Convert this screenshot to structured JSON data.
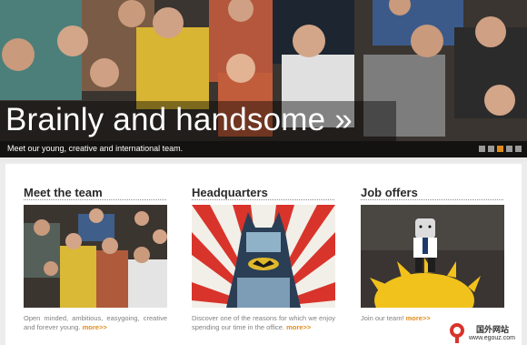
{
  "hero": {
    "title": "Brainly and handsome »",
    "caption": "Meet our young, creative and international team.",
    "slides": 5,
    "active_slide": 2
  },
  "columns": [
    {
      "title": "Meet the team",
      "text": "Open minded, ambitious, easygoing, creative and forever young.",
      "more": "more>>"
    },
    {
      "title": "Headquarters",
      "text": "Discover one of the reasons for which we enjoy spending our time in the office.",
      "more": "more>>"
    },
    {
      "title": "Job offers",
      "text": "Join our team!",
      "more": "more>>"
    }
  ],
  "watermark": {
    "text": "国外网站",
    "url": "www.egouz.com"
  },
  "colors": {
    "accent": "#e08c1a",
    "heading": "#2a2a2a",
    "body_text": "#808080"
  }
}
